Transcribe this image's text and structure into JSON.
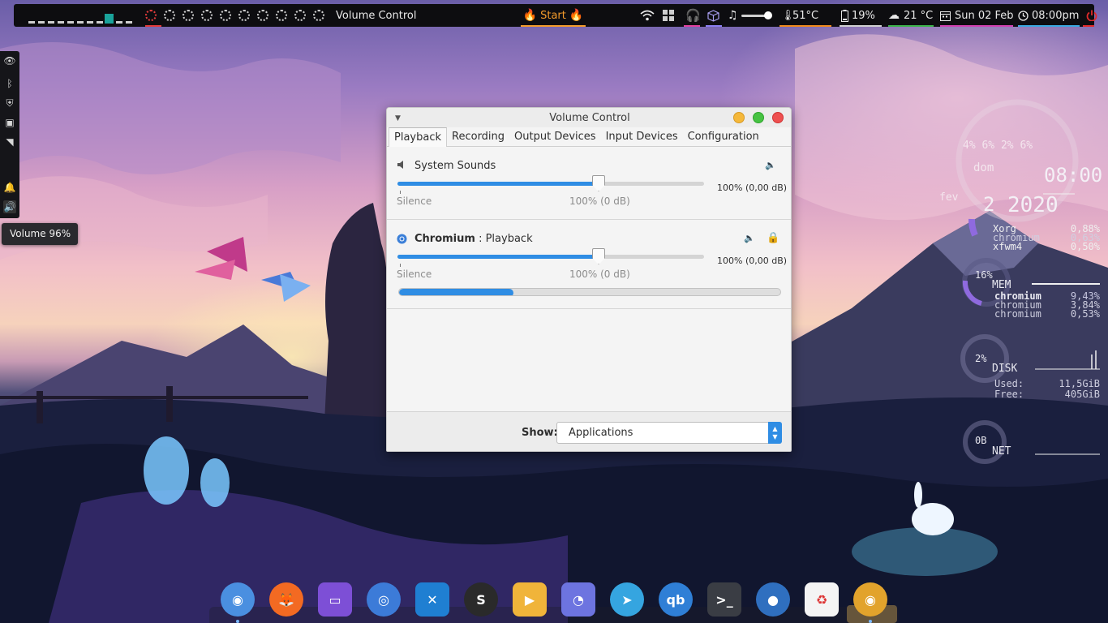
{
  "top_panel": {
    "window_title": "Volume Control",
    "start_label": "Start",
    "cpu_temp": "51°C",
    "battery": "19%",
    "weather": "21 °C",
    "date": "Sun 02 Feb",
    "time": "08:00pm",
    "workspace_count": 10,
    "colors": {
      "start": "#f39b2b",
      "temp": "#f08a1c",
      "battery": "#d0d0d0",
      "weather": "#3bb34a",
      "date": "#d040b0",
      "time": "#3aa8e0",
      "power": "#e02a2a"
    }
  },
  "left_panel": {
    "tooltip": "Volume 96%"
  },
  "conky": {
    "cpu_cores": "4% 6% 2% 6%",
    "day": "dom",
    "time": "08:00",
    "month": "fev",
    "day_num": "2",
    "year": "2020",
    "cpu_procs": [
      {
        "name": "Xorg",
        "value": "0,88%"
      },
      {
        "name": "chromium",
        "value": "0,63%"
      },
      {
        "name": "xfwm4",
        "value": "0,50%"
      }
    ],
    "mem_percent": "16%",
    "mem_label": "MEM",
    "mem_procs": [
      {
        "name": "chromium",
        "value": "9,43%"
      },
      {
        "name": "chromium",
        "value": "3,84%"
      },
      {
        "name": "chromium",
        "value": "0,53%"
      }
    ],
    "disk_percent": "2%",
    "disk_label": "DISK",
    "disk_used_label": "Used:",
    "disk_used": "11,5GiB",
    "disk_free_label": "Free:",
    "disk_free": "405GiB",
    "net_value": "0B",
    "net_label": "NET"
  },
  "volume_control": {
    "title": "Volume Control",
    "tabs": [
      "Playback",
      "Recording",
      "Output Devices",
      "Input Devices",
      "Configuration"
    ],
    "streams": [
      {
        "name": "System Sounds",
        "app": "",
        "level": 1.0,
        "value": "100% (0,00 dB)",
        "silence": "Silence",
        "mid": "100% (0 dB)"
      },
      {
        "name": "Chromium",
        "app": " : Playback",
        "level": 1.0,
        "value": "100% (0,00 dB)",
        "silence": "Silence",
        "mid": "100% (0 dB)",
        "peak": 0.3
      }
    ],
    "show_label": "Show:",
    "show_value": "Applications",
    "accent": "#2f8de4"
  },
  "dock": {
    "apps": [
      {
        "name": "chromium",
        "color": "#4a8fe0",
        "dot": true
      },
      {
        "name": "firefox",
        "color": "#f36a22",
        "dot": false
      },
      {
        "name": "files",
        "color": "#7d4fd6",
        "dot": false
      },
      {
        "name": "browser-compass",
        "color": "#3c7bd8",
        "dot": false
      },
      {
        "name": "vscode",
        "color": "#1f7fd2",
        "dot": false
      },
      {
        "name": "simplenote",
        "color": "#2a2a2a",
        "dot": false
      },
      {
        "name": "video-player",
        "color": "#f0b43a",
        "dot": false
      },
      {
        "name": "discord",
        "color": "#6d74e0",
        "dot": false
      },
      {
        "name": "telegram",
        "color": "#35a5e0",
        "dot": false
      },
      {
        "name": "qbittorrent",
        "color": "#2f7fd6",
        "dot": false
      },
      {
        "name": "terminal",
        "color": "#3a3d44",
        "dot": false
      },
      {
        "name": "toggle-settings",
        "color": "#2f6fbf",
        "dot": false
      },
      {
        "name": "trash",
        "color": "#f4f4f4",
        "dot": false
      },
      {
        "name": "volume-app",
        "color": "#e2a32c",
        "dot": true
      }
    ]
  }
}
